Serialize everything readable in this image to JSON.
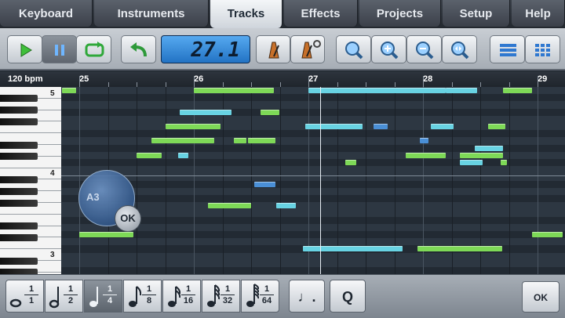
{
  "tabs": [
    {
      "id": "keyboard",
      "label": "Keyboard"
    },
    {
      "id": "instruments",
      "label": "Instruments"
    },
    {
      "id": "tracks",
      "label": "Tracks",
      "active": true
    },
    {
      "id": "effects",
      "label": "Effects"
    },
    {
      "id": "projects",
      "label": "Projects"
    },
    {
      "id": "setup",
      "label": "Setup"
    },
    {
      "id": "help",
      "label": "Help"
    }
  ],
  "toolbar": {
    "position_display": "27.1",
    "icons": [
      "play-icon",
      "pause-icon",
      "loop-icon",
      "undo-icon",
      "metronome-icon",
      "metronome-settings-icon",
      "zoom-icon",
      "zoom-in-icon",
      "zoom-out-icon",
      "zoom-fit-icon",
      "list-view-icon",
      "grid-view-icon"
    ]
  },
  "ruler": {
    "tempo": "120 bpm",
    "bars": [
      "25",
      "26",
      "27",
      "28",
      "29"
    ]
  },
  "keyboard": {
    "octave_labels": [
      "5",
      "4",
      "3"
    ]
  },
  "pitch_picker": {
    "note": "A3",
    "ok_label": "OK"
  },
  "colors": {
    "note_green": "#7ed957",
    "note_cyan": "#68d3e3",
    "note_blue": "#4a8fd6",
    "active_tab": "#e9edf1",
    "lcd": "#3f95e6"
  },
  "notes": [
    {
      "row": 0,
      "start": 24.85,
      "len": 0.12,
      "color": "green"
    },
    {
      "row": 0,
      "start": 26.0,
      "len": 0.7,
      "color": "green"
    },
    {
      "row": 0,
      "start": 27.0,
      "len": 1.2,
      "color": "cyan"
    },
    {
      "row": 0,
      "start": 28.2,
      "len": 0.27,
      "color": "cyan"
    },
    {
      "row": 0,
      "start": 28.7,
      "len": 0.25,
      "color": "green"
    },
    {
      "row": 3,
      "start": 25.88,
      "len": 0.45,
      "color": "cyan"
    },
    {
      "row": 3,
      "start": 26.58,
      "len": 0.17,
      "color": "green"
    },
    {
      "row": 5,
      "start": 25.75,
      "len": 0.48,
      "color": "green"
    },
    {
      "row": 5,
      "start": 26.97,
      "len": 0.5,
      "color": "cyan"
    },
    {
      "row": 5,
      "start": 27.57,
      "len": 0.12,
      "color": "blue"
    },
    {
      "row": 5,
      "start": 28.07,
      "len": 0.2,
      "color": "cyan"
    },
    {
      "row": 5,
      "start": 28.57,
      "len": 0.15,
      "color": "green"
    },
    {
      "row": 7,
      "start": 25.63,
      "len": 0.55,
      "color": "green"
    },
    {
      "row": 7,
      "start": 26.35,
      "len": 0.11,
      "color": "green"
    },
    {
      "row": 7,
      "start": 26.47,
      "len": 0.24,
      "color": "green"
    },
    {
      "row": 7,
      "start": 27.97,
      "len": 0.08,
      "color": "blue"
    },
    {
      "row": 8,
      "start": 28.45,
      "len": 0.25,
      "color": "cyan"
    },
    {
      "row": 9,
      "start": 25.5,
      "len": 0.22,
      "color": "green"
    },
    {
      "row": 9,
      "start": 25.86,
      "len": 0.09,
      "color": "cyan"
    },
    {
      "row": 9,
      "start": 27.85,
      "len": 0.35,
      "color": "green"
    },
    {
      "row": 9,
      "start": 28.32,
      "len": 0.38,
      "color": "green"
    },
    {
      "row": 10,
      "start": 27.32,
      "len": 0.1,
      "color": "green"
    },
    {
      "row": 10,
      "start": 28.32,
      "len": 0.2,
      "color": "cyan"
    },
    {
      "row": 10,
      "start": 28.68,
      "len": 0.05,
      "color": "green"
    },
    {
      "row": 13,
      "start": 26.53,
      "len": 0.18,
      "color": "blue"
    },
    {
      "row": 16,
      "start": 26.12,
      "len": 0.38,
      "color": "green"
    },
    {
      "row": 16,
      "start": 26.72,
      "len": 0.17,
      "color": "cyan"
    },
    {
      "row": 20,
      "start": 25.0,
      "len": 0.47,
      "color": "green"
    },
    {
      "row": 20,
      "start": 28.95,
      "len": 0.27,
      "color": "green"
    },
    {
      "row": 22,
      "start": 26.95,
      "len": 0.87,
      "color": "cyan"
    },
    {
      "row": 22,
      "start": 27.95,
      "len": 0.74,
      "color": "green"
    }
  ],
  "note_values": [
    {
      "num": "1",
      "den": "1"
    },
    {
      "num": "1",
      "den": "2"
    },
    {
      "num": "1",
      "den": "4",
      "active": true
    },
    {
      "num": "1",
      "den": "8"
    },
    {
      "num": "1",
      "den": "16"
    },
    {
      "num": "1",
      "den": "32"
    },
    {
      "num": "1",
      "den": "64"
    }
  ],
  "bottombar": {
    "dotted_label": "♩.",
    "quantize_label": "Q",
    "ok_label": "OK"
  }
}
